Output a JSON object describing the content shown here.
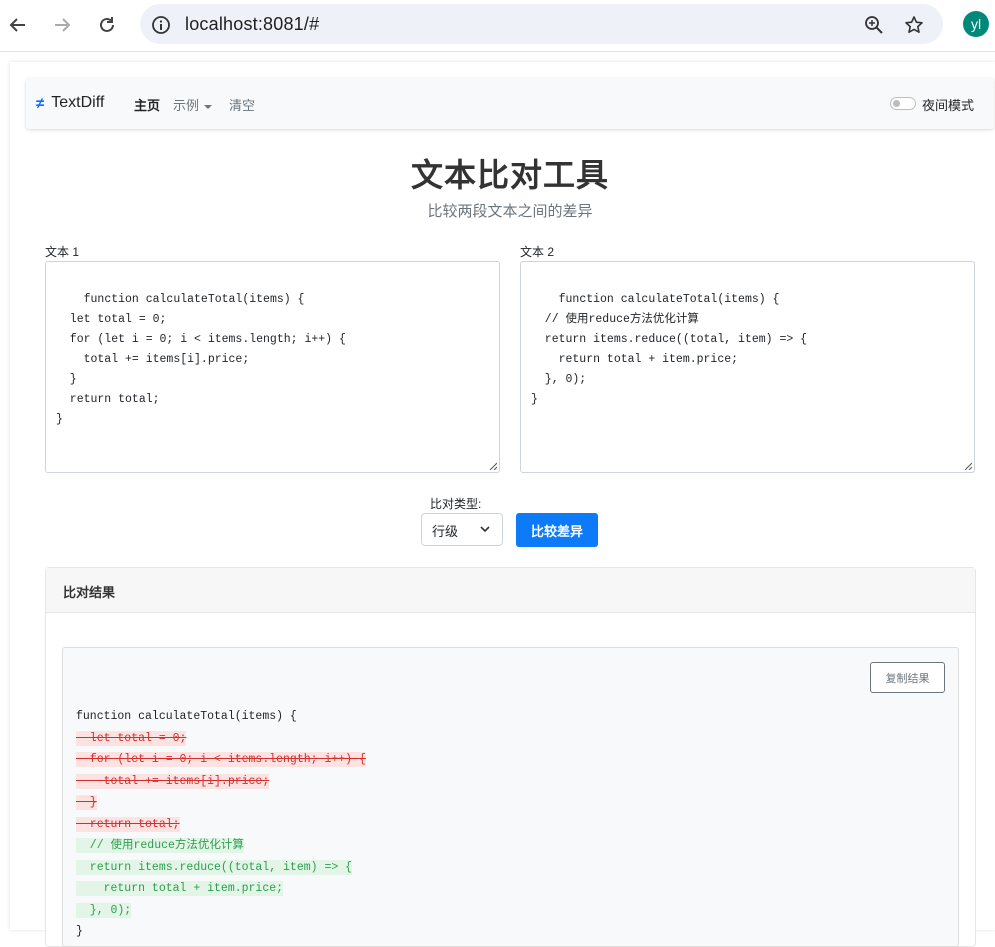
{
  "browser": {
    "url": "localhost:8081/#",
    "avatar_initials": "yl"
  },
  "navbar": {
    "brand_icon": "≠",
    "brand": "TextDiff",
    "items": [
      {
        "label": "主页"
      },
      {
        "label": "示例"
      },
      {
        "label": "清空"
      }
    ],
    "night_mode_label": "夜间模式"
  },
  "header": {
    "title": "文本比对工具",
    "subtitle": "比较两段文本之间的差异"
  },
  "inputs": {
    "text1_label": "文本 1",
    "text1_value": "function calculateTotal(items) {\n  let total = 0;\n  for (let i = 0; i < items.length; i++) {\n    total += items[i].price;\n  }\n  return total;\n}",
    "text2_label": "文本 2",
    "text2_value": "function calculateTotal(items) {\n  // 使用reduce方法优化计算\n  return items.reduce((total, item) => {\n    return total + item.price;\n  }, 0);\n}"
  },
  "controls": {
    "compare_type_label": "比对类型:",
    "compare_type_value": "行级",
    "compare_button": "比较差异"
  },
  "result": {
    "header": "比对结果",
    "copy_button": "复制结果",
    "lines": [
      {
        "type": "same",
        "text": "function calculateTotal(items) {"
      },
      {
        "type": "del",
        "text": "  let total = 0;"
      },
      {
        "type": "del",
        "text": "  for (let i = 0; i < items.length; i++) {"
      },
      {
        "type": "del",
        "text": "    total += items[i].price;"
      },
      {
        "type": "del",
        "text": "  }"
      },
      {
        "type": "del",
        "text": "  return total;"
      },
      {
        "type": "add",
        "text": "  // 使用reduce方法优化计算"
      },
      {
        "type": "add",
        "text": "  return items.reduce((total, item) => {"
      },
      {
        "type": "add",
        "text": "    return total + item.price;"
      },
      {
        "type": "add",
        "text": "  }, 0);"
      },
      {
        "type": "same",
        "text": "}"
      }
    ]
  },
  "colors": {
    "primary": "#0d7af7",
    "deleted_bg": "#fde2e2",
    "deleted_text": "#d32f2f",
    "added_bg": "#e2f5e7",
    "added_text": "#2e9e4f"
  }
}
